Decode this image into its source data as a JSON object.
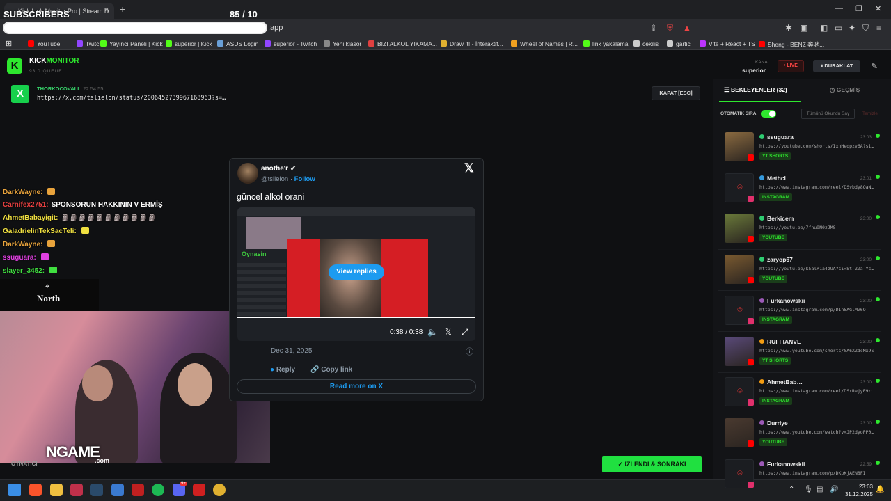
{
  "overlay": {
    "subscribers": "SUBSCRIBERS",
    "counter": "85  / 10"
  },
  "browser": {
    "tab_title": "Kick Link Monitor Pro | Stream D",
    "tab_close": "×",
    "new_tab": "+",
    "url_suffix": ".app",
    "window_controls": [
      "—",
      "❐",
      "✕"
    ],
    "bookmarks": [
      {
        "label": "YouTube",
        "color": "#ff0000"
      },
      {
        "label": "Twitch",
        "color": "#9146ff"
      },
      {
        "label": "Yayıncı Paneli | Kick",
        "color": "#53fc18"
      },
      {
        "label": "superior | Kick",
        "color": "#53fc18"
      },
      {
        "label": "ASUS Login",
        "color": "#6aa0d8"
      },
      {
        "label": "superior - Twitch",
        "color": "#9146ff"
      },
      {
        "label": "Yeni klasör",
        "color": "#888888"
      },
      {
        "label": "BIZI ALKOL YIKAMA...",
        "color": "#e04040"
      },
      {
        "label": "Draw It! - İnteraktif...",
        "color": "#e0b030"
      },
      {
        "label": "Wheel of Names | R...",
        "color": "#f0a020"
      },
      {
        "label": "link yakalama",
        "color": "#53fc18"
      },
      {
        "label": "cekilis",
        "color": "#cccccc"
      },
      {
        "label": "gartic",
        "color": "#cccccc"
      },
      {
        "label": "Vite + React + TS",
        "color": "#bd34fe"
      },
      {
        "label": "Sheng - BENZ 奔驰...",
        "color": "#ff0000"
      }
    ]
  },
  "app": {
    "logo_letter": "K",
    "name_a": "KICK",
    "name_b": "MONITOR",
    "subtitle": "93.0 QUEUE",
    "kanal_label": "KANAL",
    "kanal_value": "superior",
    "live_label": "• LIVE",
    "pause_label": "⏸  DURAKLAT",
    "close_label": "KAPAT [ESC]",
    "done_label": "✓  İZLENDİ & SONRAKİ",
    "player_label": "OYNATICI"
  },
  "current_link": {
    "platform_letter": "X",
    "sender": "THORKOCOVALI",
    "time": "22:54:55",
    "url": "https://x.com/tslielon/status/2006452739967168963?s=…"
  },
  "chat": [
    {
      "user": "DarkWayne:",
      "color": "#e8a33c",
      "msg": ""
    },
    {
      "user": "Carnifex2751:",
      "color": "#e84040",
      "msg": "SPONSORUN HAKKININ V ERMİŞ"
    },
    {
      "user": "AhmetBabayigit:",
      "color": "#f0e040",
      "msg": "🗿🗿🗿🗿🗿🗿🗿🗿🗿🗿🗿"
    },
    {
      "user": "GaladrielinTekSacTeli:",
      "color": "#f0e040",
      "msg": ""
    },
    {
      "user": "DarkWayne:",
      "color": "#e8a33c",
      "msg": ""
    },
    {
      "user": "ssuguara:",
      "color": "#e040e0",
      "msg": ""
    },
    {
      "user": "slayer_3452:",
      "color": "#40e040",
      "msg": ""
    }
  ],
  "north_logo": "North",
  "webcam_brand": {
    "main": "NGAME",
    "suffix": ".com"
  },
  "tweet": {
    "name": "anothe'r",
    "handle": "@tslielon",
    "follow": "Follow",
    "text": "güncel alkol orani",
    "view_replies": "View replies",
    "video_time": "0:38 / 0:38",
    "date": "Dec 31, 2025",
    "reply": "Reply",
    "copy_link": "Copy link",
    "read_more": "Read more on X",
    "media_green_text": "Oynasin"
  },
  "panel": {
    "tab_waiting": "BEKLEYENLER (32)",
    "tab_history": "GEÇMİŞ",
    "auto_queue": "OTOMATİK SIRA",
    "mark_all": "Tümünü Okundu Say",
    "clear": "Temizle",
    "items": [
      {
        "name": "ssuguara",
        "time": "23:03",
        "url": "https://youtube.com/shorts/IxnHedpzv6A?si…",
        "badge": "YT SHORTS",
        "dot": "#2ecc71",
        "thumb": true,
        "thumbColor": "#8a6a40",
        "plat": "#ff0000"
      },
      {
        "name": "Methci",
        "time": "23:01",
        "url": "https://www.instagram.com/reel/DSvbdy8OaN…",
        "badge": "INSTAGRAM",
        "dot": "#3498db",
        "thumb": false,
        "thumbColor": "#1b1d21",
        "plat": "#e1306c"
      },
      {
        "name": "Berkicem",
        "time": "23:00",
        "url": "https://youtu.be/7fnu9N0zJM8",
        "badge": "YOUTUBE",
        "dot": "#2ecc71",
        "thumb": true,
        "thumbColor": "#6a7a3a",
        "plat": "#ff0000"
      },
      {
        "name": "zaryop67",
        "time": "23:00",
        "url": "https://youtu.be/k5alR1a4zUA?si=St-ZZa-Yc…",
        "badge": "YOUTUBE",
        "dot": "#2ecc71",
        "thumb": true,
        "thumbColor": "#7a5a30",
        "plat": "#ff0000"
      },
      {
        "name": "Furkanowskii",
        "time": "23:00",
        "url": "https://www.instagram.com/p/DIn5AGlMV6Q",
        "badge": "INSTAGRAM",
        "dot": "#9b59b6",
        "thumb": false,
        "thumbColor": "#1b1d21",
        "plat": "#e1306c"
      },
      {
        "name": "RUFFIANVL",
        "time": "23:00",
        "url": "https://www.youtube.com/shorts/0A6XZdcMx9S",
        "badge": "YT SHORTS",
        "dot": "#f39c12",
        "thumb": true,
        "thumbColor": "#5a4a7a",
        "plat": "#ff0000"
      },
      {
        "name": "AhmetBab…",
        "time": "23:00",
        "url": "https://www.instagram.com/reel/DSxRejyE9r…",
        "badge": "INSTAGRAM",
        "dot": "#f39c12",
        "thumb": false,
        "thumbColor": "#1b1d21",
        "plat": "#e1306c"
      },
      {
        "name": "Durriye",
        "time": "23:00",
        "url": "https://www.youtube.com/watch?v=JP2dyoPP0…",
        "badge": "YOUTUBE",
        "dot": "#9b59b6",
        "thumb": true,
        "thumbColor": "#4a3a30",
        "plat": "#ff0000"
      },
      {
        "name": "Furkanowskii",
        "time": "22:59",
        "url": "https://www.instagram.com/p/DKpKjAEN8FI",
        "badge": "",
        "dot": "#9b59b6",
        "thumb": false,
        "thumbColor": "#1b1d21",
        "plat": "#e1306c"
      }
    ]
  },
  "taskbar": {
    "clock_time": "23:03",
    "clock_date": "31.12.2025",
    "badge": "9+"
  }
}
